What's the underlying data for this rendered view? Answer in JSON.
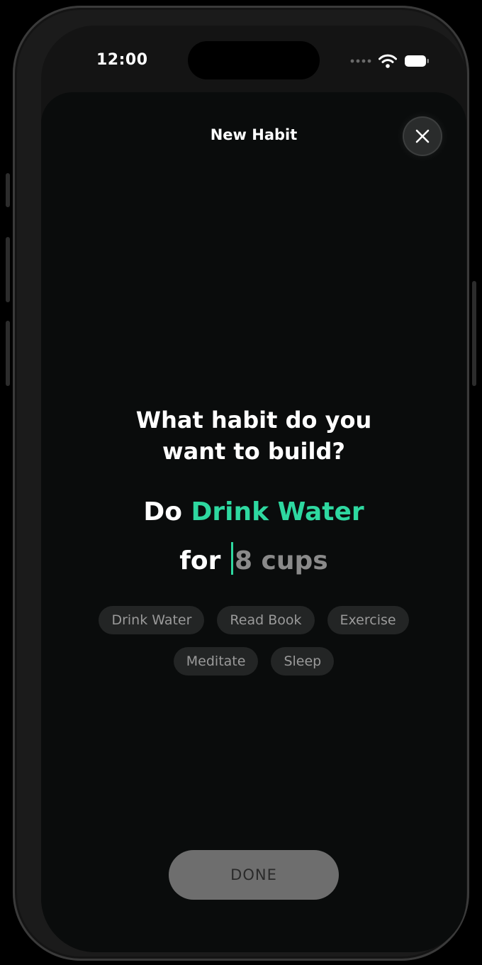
{
  "status_bar": {
    "time": "12:00",
    "signal_icon": "signal-dots-icon",
    "wifi_icon": "wifi-icon",
    "battery_icon": "battery-icon"
  },
  "header": {
    "title": "New Habit",
    "close_icon": "close-icon"
  },
  "prompt": {
    "question_line1": "What habit do you",
    "question_line2": "want to build?"
  },
  "habit_sentence": {
    "verb": "Do",
    "habit_name": "Drink Water",
    "connector": "for",
    "amount_placeholder": "8 cups"
  },
  "suggestions": [
    "Drink Water",
    "Read Book",
    "Exercise",
    "Meditate",
    "Sleep"
  ],
  "footer": {
    "done_label": "DONE"
  },
  "colors": {
    "accent": "#2ed8a0",
    "background": "#0a0c0c",
    "chip": "#232525",
    "button_disabled": "#6e6e6e"
  }
}
